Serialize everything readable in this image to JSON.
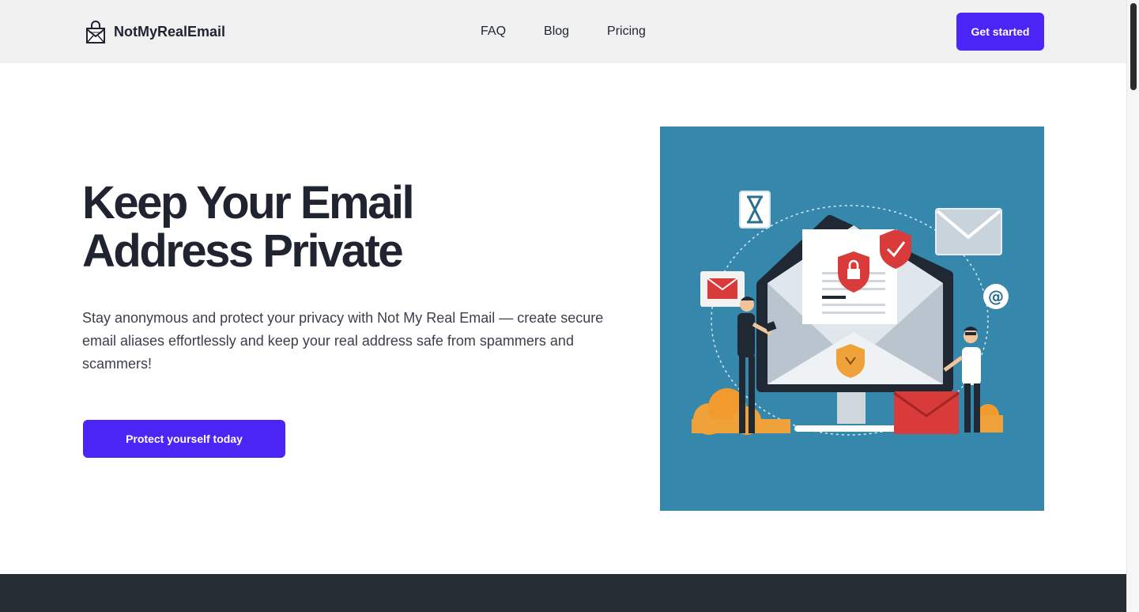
{
  "header": {
    "brand_name": "NotMyRealEmail",
    "logo_icon": "envelope-lock-icon",
    "nav": [
      {
        "label": "FAQ"
      },
      {
        "label": "Blog"
      },
      {
        "label": "Pricing"
      }
    ],
    "cta_label": "Get started"
  },
  "hero": {
    "title_line1": "Keep Your Email",
    "title_line2": "Address Private",
    "description": "Stay anonymous and protect your privacy with Not My Real Email — create secure email aliases effortlessly and keep your real address safe from spammers and scammers!",
    "cta_label": "Protect yourself today",
    "illustration_icon": "email-privacy-illustration"
  },
  "colors": {
    "accent": "#4a25f5",
    "header_bg": "#f0f0f0",
    "illustration_bg": "#3587ab",
    "dark_band": "#272d35",
    "text": "#1f2430"
  }
}
